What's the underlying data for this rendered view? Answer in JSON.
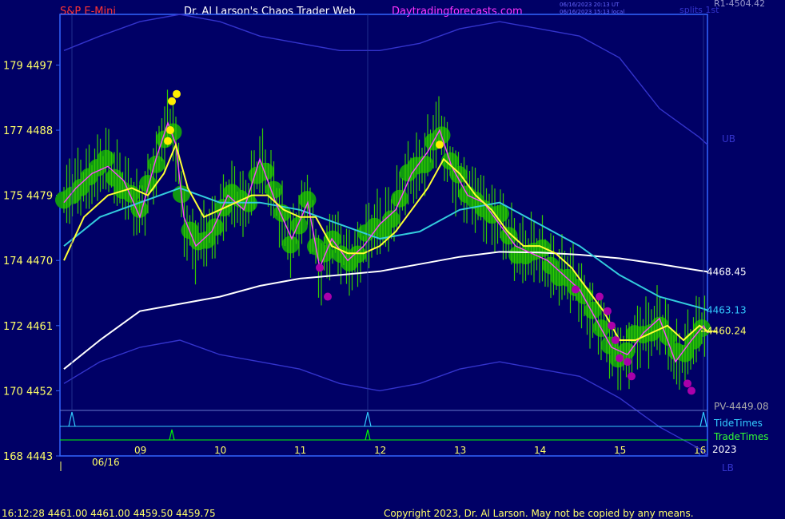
{
  "header": {
    "symbol": "S&P E-Mini",
    "title": "Dr. Al Larson's Chaos Trader Web",
    "site": "Daytradingforecasts.com",
    "timestamp_utc": "06/16/2023 20:13 UT",
    "timestamp_local": "06/16/2023 15:13 local",
    "splits": "splits 1st",
    "r1": "R1-4504.42"
  },
  "footer": {
    "last_bar": "16:12:28  4461.00 4461.00 4459.50 4459.75",
    "copyright": "Copyright 2023, Dr. Al Larson. May not be copied by any means."
  },
  "right_labels": {
    "ub": "UB",
    "lb": "LB",
    "pv": "PV-4449.08",
    "tide_times": "TideTimes",
    "trade_times": "TradeTimes",
    "year": "2023"
  },
  "colors": {
    "background": "#000066",
    "frame": "#3366ff",
    "price_bars": "#33cc00",
    "glow": "#119911",
    "yellow_line": "#ffff33",
    "cyan_line": "#33ccdd",
    "white_line": "#ffffff",
    "magenta_line": "#ff44ff",
    "band": "#3333cc",
    "dots_top": "#ffee00",
    "dots_bottom": "#aa00aa",
    "axis_text": "#ffff66",
    "header_red": "#ff3333",
    "header_white": "#ffffff",
    "header_magenta": "#ff33ff",
    "tide_green": "#00ff00"
  },
  "chart_data": {
    "type": "line",
    "title": "S&P E-Mini",
    "y_axis": {
      "range": [
        4443,
        4504
      ],
      "ticks": [
        {
          "value": 4443,
          "left": "168",
          "right": "4443"
        },
        {
          "value": 4452,
          "left": "170",
          "right": "4452"
        },
        {
          "value": 4461,
          "left": "172",
          "right": "4461"
        },
        {
          "value": 4470,
          "left": "174",
          "right": "4470"
        },
        {
          "value": 4479,
          "left": "175",
          "right": "4479"
        },
        {
          "value": 4488,
          "left": "177",
          "right": "4488"
        },
        {
          "value": 4497,
          "left": "179",
          "right": "4497"
        }
      ]
    },
    "x_axis": {
      "range": [
        8.0,
        16.1
      ],
      "start_label": "06/16",
      "ticks": [
        {
          "x": 9,
          "label": "09"
        },
        {
          "x": 10,
          "label": "10"
        },
        {
          "x": 11,
          "label": "11"
        },
        {
          "x": 12,
          "label": "12"
        },
        {
          "x": 13,
          "label": "13"
        },
        {
          "x": 14,
          "label": "14"
        },
        {
          "x": 15,
          "label": "15"
        },
        {
          "x": 16,
          "label": "16"
        }
      ]
    },
    "series": [
      {
        "name": "price",
        "x": [
          8.05,
          8.2,
          8.4,
          8.6,
          8.8,
          9.0,
          9.2,
          9.35,
          9.45,
          9.55,
          9.7,
          9.9,
          10.1,
          10.3,
          10.5,
          10.7,
          10.9,
          11.1,
          11.25,
          11.4,
          11.6,
          11.8,
          12.0,
          12.2,
          12.4,
          12.6,
          12.75,
          12.9,
          13.1,
          13.3,
          13.5,
          13.7,
          13.9,
          14.1,
          14.3,
          14.5,
          14.7,
          14.9,
          15.1,
          15.3,
          15.5,
          15.7,
          15.9,
          16.05,
          16.1
        ],
        "y": [
          4478,
          4480,
          4482,
          4483,
          4481,
          4476,
          4484,
          4489,
          4486,
          4476,
          4472,
          4474,
          4479,
          4477,
          4484,
          4478,
          4473,
          4478,
          4469,
          4473,
          4470,
          4472,
          4475,
          4477,
          4482,
          4485,
          4488,
          4483,
          4479,
          4478,
          4475,
          4472,
          4471,
          4470,
          4468,
          4466,
          4462,
          4458,
          4457,
          4460,
          4462,
          4456,
          4459,
          4461,
          4460
        ]
      },
      {
        "name": "yellow",
        "x": [
          8.05,
          8.3,
          8.6,
          8.9,
          9.1,
          9.3,
          9.45,
          9.6,
          9.8,
          10.0,
          10.2,
          10.4,
          10.6,
          10.8,
          11.0,
          11.2,
          11.4,
          11.6,
          11.8,
          12.0,
          12.2,
          12.4,
          12.6,
          12.8,
          13.0,
          13.2,
          13.4,
          13.6,
          13.8,
          14.0,
          14.2,
          14.4,
          14.6,
          14.8,
          15.0,
          15.2,
          15.4,
          15.6,
          15.8,
          16.0,
          16.1
        ],
        "y": [
          4470,
          4476,
          4479,
          4480,
          4479,
          4482,
          4486,
          4480,
          4476,
          4477,
          4478,
          4479,
          4479,
          4477,
          4476,
          4476,
          4472,
          4471,
          4471,
          4472,
          4474,
          4477,
          4480,
          4484,
          4482,
          4479,
          4477,
          4474,
          4472,
          4472,
          4471,
          4469,
          4466,
          4463,
          4459,
          4459,
          4460,
          4461,
          4459,
          4461,
          4460.24
        ]
      },
      {
        "name": "cyan",
        "x": [
          8.05,
          8.5,
          9.0,
          9.5,
          10.0,
          10.5,
          11.0,
          11.5,
          12.0,
          12.5,
          13.0,
          13.5,
          14.0,
          14.5,
          15.0,
          15.5,
          16.0,
          16.1
        ],
        "y": [
          4472,
          4476,
          4478,
          4480,
          4478,
          4478,
          4477,
          4475,
          4473,
          4474,
          4477,
          4478,
          4475,
          4472,
          4468,
          4465,
          4463.5,
          4463.13
        ]
      },
      {
        "name": "white",
        "x": [
          8.05,
          8.5,
          9.0,
          9.5,
          10.0,
          10.5,
          11.0,
          11.5,
          12.0,
          12.5,
          13.0,
          13.5,
          14.0,
          14.5,
          15.0,
          15.5,
          16.0,
          16.1
        ],
        "y": [
          4455,
          4459,
          4463,
          4464,
          4465,
          4466.5,
          4467.5,
          4468,
          4468.5,
          4469.5,
          4470.5,
          4471.2,
          4471.1,
          4470.8,
          4470.3,
          4469.5,
          4468.6,
          4468.45
        ]
      },
      {
        "name": "upper-band",
        "x": [
          8.05,
          8.5,
          9.0,
          9.5,
          10.0,
          10.5,
          11.0,
          11.5,
          12.0,
          12.5,
          13.0,
          13.5,
          14.0,
          14.5,
          15.0,
          15.5,
          16.0,
          16.1
        ],
        "y": [
          4499,
          4501,
          4503,
          4504,
          4503,
          4501,
          4500,
          4499,
          4499,
          4500,
          4502,
          4503,
          4502,
          4501,
          4498,
          4491,
          4487,
          4486
        ]
      },
      {
        "name": "lower-band",
        "x": [
          8.05,
          8.5,
          9.0,
          9.5,
          10.0,
          10.5,
          11.0,
          11.5,
          12.0,
          12.5,
          13.0,
          13.5,
          14.0,
          14.5,
          15.0,
          15.5,
          16.0,
          16.1
        ],
        "y": [
          4453,
          4456,
          4458,
          4459,
          4457,
          4456,
          4455,
          4453,
          4452,
          4453,
          4455,
          4456,
          4455,
          4454,
          4451,
          4447,
          4444,
          4443
        ]
      }
    ],
    "value_labels": [
      {
        "series": "white",
        "label": "4468.45",
        "value": 4468.45
      },
      {
        "series": "cyan",
        "label": "4463.13",
        "value": 4463.13
      },
      {
        "series": "yellow",
        "label": "4460.24",
        "value": 4460.24
      }
    ],
    "markers_top": [
      {
        "x": 9.35,
        "y": 4486.5
      },
      {
        "x": 9.38,
        "y": 4488
      },
      {
        "x": 9.4,
        "y": 4492
      },
      {
        "x": 9.46,
        "y": 4493
      },
      {
        "x": 12.75,
        "y": 4486
      }
    ],
    "markers_bottom": [
      {
        "x": 11.25,
        "y": 4469
      },
      {
        "x": 11.35,
        "y": 4465
      },
      {
        "x": 14.45,
        "y": 4466
      },
      {
        "x": 14.75,
        "y": 4465
      },
      {
        "x": 14.85,
        "y": 4463
      },
      {
        "x": 14.9,
        "y": 4461
      },
      {
        "x": 14.95,
        "y": 4459
      },
      {
        "x": 15.0,
        "y": 4456.5
      },
      {
        "x": 15.1,
        "y": 4456
      },
      {
        "x": 15.15,
        "y": 4454
      },
      {
        "x": 15.85,
        "y": 4453
      },
      {
        "x": 15.9,
        "y": 4452
      }
    ],
    "tide_times": [
      8.15,
      11.85,
      16.05
    ],
    "trade_times": [
      9.4,
      11.85
    ],
    "grid": false
  }
}
